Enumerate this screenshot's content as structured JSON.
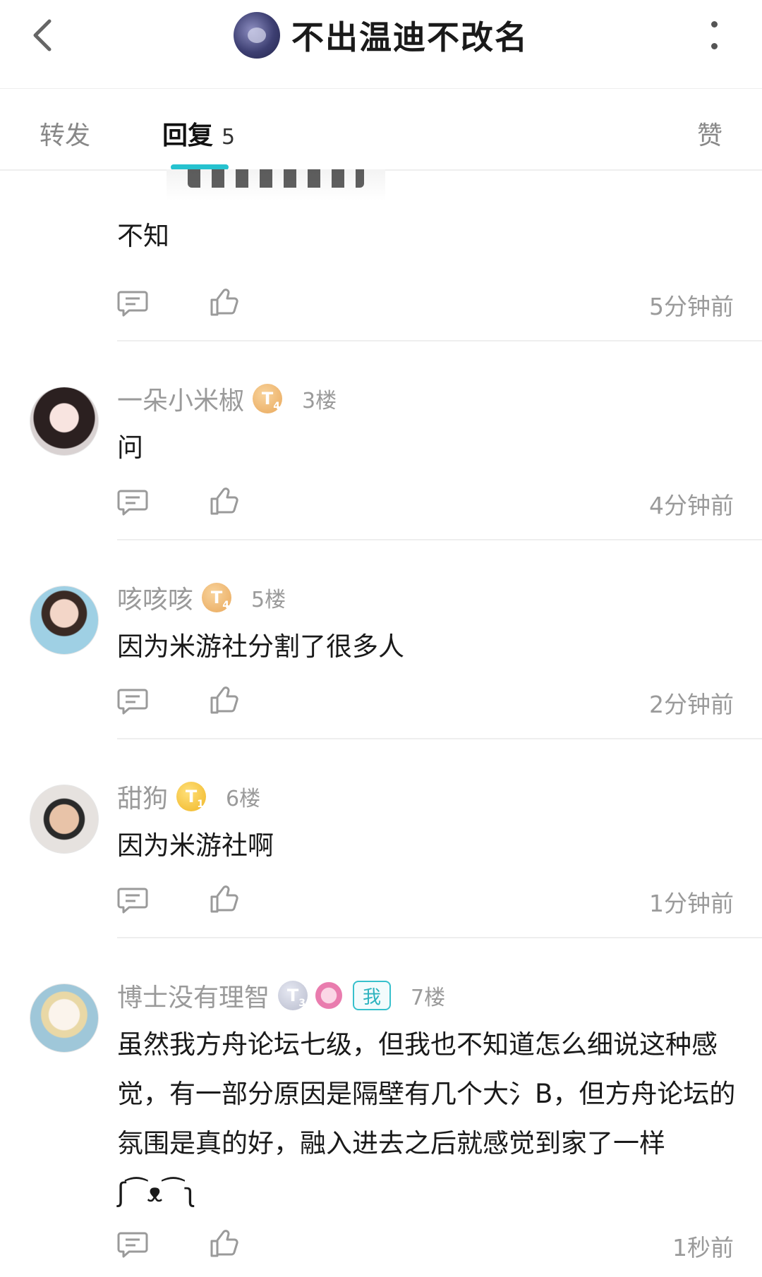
{
  "header": {
    "title": "不出温迪不改名",
    "back_icon": "back-chevron-icon",
    "more_icon": "more-vertical-icon"
  },
  "tabs": {
    "forward": "转发",
    "reply": "回复",
    "reply_count": "5",
    "like": "赞",
    "active": "reply",
    "accent_color": "#26c2cf"
  },
  "comments": [
    {
      "content": "不知",
      "time": "5分钟前"
    },
    {
      "username": "一朵小米椒",
      "floor": "3楼",
      "content": "问",
      "time": "4分钟前",
      "badge_icon": "level-t4-badge-icon"
    },
    {
      "username": "咳咳咳",
      "floor": "5楼",
      "content": "因为米游社分割了很多人",
      "time": "2分钟前",
      "badge_icon": "level-t4-badge-icon"
    },
    {
      "username": "甜狗",
      "floor": "6楼",
      "content": "因为米游社啊",
      "time": "1分钟前",
      "badge_icon": "level-t1-badge-icon"
    },
    {
      "username": "博士没有理智",
      "floor": "7楼",
      "me_tag": "我",
      "content": "虽然我方舟论坛七级，但我也不知道怎么细说这种感觉，有一部分原因是隔壁有几个大氵B，但方舟论坛的氛围是真的好，融入进去之后就感觉到家了一样ʃ⁀ᴥ⁀ʅ",
      "time": "1秒前",
      "badge_icon": "level-t3-badge-icon"
    }
  ]
}
